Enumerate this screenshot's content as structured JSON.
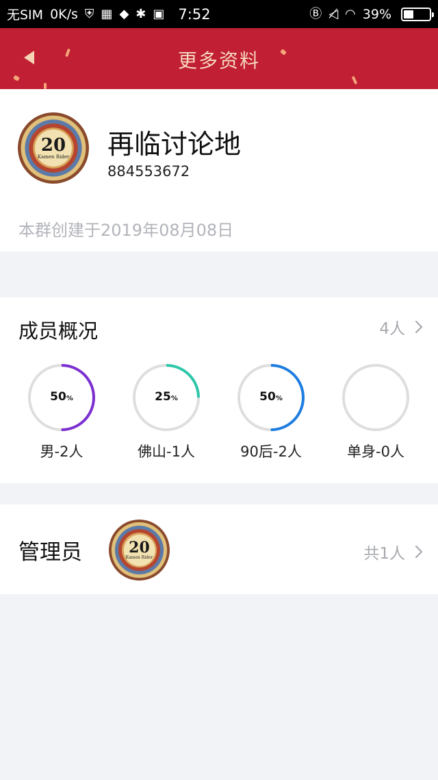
{
  "status_bar": {
    "carrier": "无SIM",
    "speed": "0K/s",
    "time": "7:52",
    "battery_percent_text": "39%",
    "battery_level": 0.39
  },
  "header": {
    "title": "更多资料",
    "background": "#c11f33"
  },
  "group": {
    "name": "再临讨论地",
    "id": "884553672",
    "created_text": "本群创建于2019年08月08日",
    "avatar_icon": "group-avatar-kamen-rider-20"
  },
  "members": {
    "title": "成员概况",
    "count": "4人",
    "stats": [
      {
        "percent": "50",
        "unit": "%",
        "value": 0.5,
        "color": "#7b2fd0",
        "label": "男-2人"
      },
      {
        "percent": "25",
        "unit": "%",
        "value": 0.25,
        "color": "#2dc7a9",
        "label": "佛山-1人"
      },
      {
        "percent": "50",
        "unit": "%",
        "value": 0.5,
        "color": "#1d7de0",
        "label": "90后-2人"
      },
      {
        "percent": "",
        "unit": "",
        "value": 0.0,
        "color": "#cccccc",
        "label": "单身-0人"
      }
    ]
  },
  "admins": {
    "title": "管理员",
    "count": "共1人"
  },
  "colors": {
    "ring_track": "#dedede",
    "muted_text": "#a7a9ae",
    "page_background": "#f2f3f7"
  }
}
